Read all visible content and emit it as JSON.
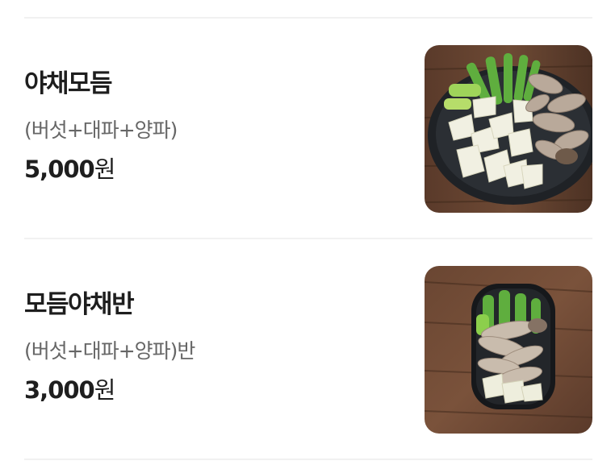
{
  "menu": {
    "items": [
      {
        "name": "야채모듬",
        "description": "(버섯+대파+양파)",
        "price": "5,000",
        "currency": "원"
      },
      {
        "name": "모듬야채반",
        "description": "(버섯+대파+양파)반",
        "price": "3,000",
        "currency": "원"
      }
    ]
  },
  "colors": {
    "divider": "#f1f1f1",
    "title_text": "#1e1e1e",
    "description_text": "#666666"
  },
  "icons": {
    "item_1_image": "round-plate-vegetables-photo",
    "item_2_image": "oval-plate-vegetables-photo"
  }
}
